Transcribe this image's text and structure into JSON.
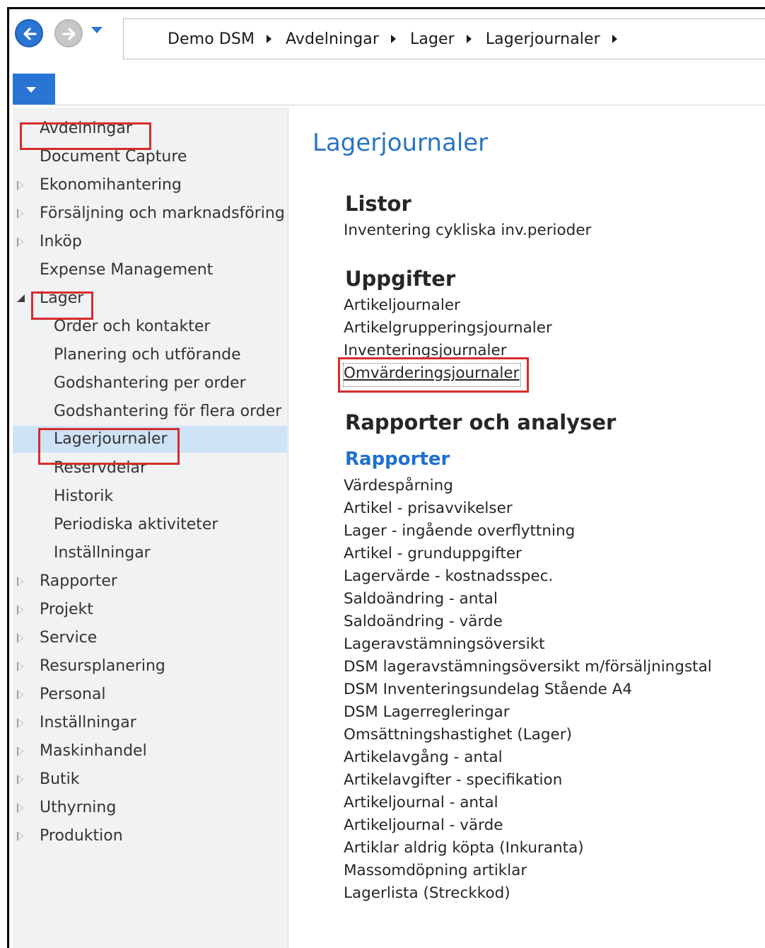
{
  "breadcrumb": [
    "Demo DSM",
    "Avdelningar",
    "Lager",
    "Lagerjournaler"
  ],
  "nav": [
    {
      "label": "Avdelningar",
      "level": 0,
      "expander": "none",
      "highlighted": true
    },
    {
      "label": "Document Capture",
      "level": 0,
      "expander": "none"
    },
    {
      "label": "Ekonomihantering",
      "level": 0,
      "expander": "collapsed"
    },
    {
      "label": "Försäljning och marknadsföring",
      "level": 0,
      "expander": "collapsed"
    },
    {
      "label": "Inköp",
      "level": 0,
      "expander": "collapsed"
    },
    {
      "label": "Expense Management",
      "level": 0,
      "expander": "none"
    },
    {
      "label": "Lager",
      "level": 0,
      "expander": "expanded",
      "highlighted": true
    },
    {
      "label": "Order och kontakter",
      "level": 1
    },
    {
      "label": "Planering och utförande",
      "level": 1
    },
    {
      "label": "Godshantering per order",
      "level": 1
    },
    {
      "label": "Godshantering för flera order",
      "level": 1
    },
    {
      "label": "Lagerjournaler",
      "level": 1,
      "selected": true,
      "highlighted": true
    },
    {
      "label": "Reservdelar",
      "level": 1
    },
    {
      "label": "Historik",
      "level": 1
    },
    {
      "label": "Periodiska aktiviteter",
      "level": 1
    },
    {
      "label": "Inställningar",
      "level": 1
    },
    {
      "label": "Rapporter",
      "level": 0,
      "expander": "collapsed"
    },
    {
      "label": "Projekt",
      "level": 0,
      "expander": "collapsed"
    },
    {
      "label": "Service",
      "level": 0,
      "expander": "collapsed"
    },
    {
      "label": "Resursplanering",
      "level": 0,
      "expander": "collapsed"
    },
    {
      "label": "Personal",
      "level": 0,
      "expander": "collapsed"
    },
    {
      "label": "Inställningar",
      "level": 0,
      "expander": "collapsed"
    },
    {
      "label": "Maskinhandel",
      "level": 0,
      "expander": "collapsed"
    },
    {
      "label": "Butik",
      "level": 0,
      "expander": "collapsed"
    },
    {
      "label": "Uthyrning",
      "level": 0,
      "expander": "collapsed"
    },
    {
      "label": "Produktion",
      "level": 0,
      "expander": "collapsed"
    }
  ],
  "content": {
    "title": "Lagerjournaler",
    "listor": {
      "heading": "Listor",
      "items": [
        "Inventering cykliska inv.perioder"
      ]
    },
    "uppgifter": {
      "heading": "Uppgifter",
      "items": [
        "Artikeljournaler",
        "Artikelgrupperingsjournaler",
        "Inventeringsjournaler",
        "Omvärderingsjournaler"
      ]
    },
    "rapporter": {
      "heading": "Rapporter och analyser",
      "subheading": "Rapporter",
      "items": [
        "Värdespårning",
        "Artikel - prisavvikelser",
        "Lager - ingående overflyttning",
        "Artikel - grunduppgifter",
        "Lagervärde - kostnadsspec.",
        "Saldoändring - antal",
        "Saldoändring - värde",
        "Lageravstämningsöversikt",
        "DSM lageravstämningsöversikt m/försäljningstal",
        "DSM Inventeringsundelag Stående A4",
        "DSM Lagerregleringar",
        "Omsättningshastighet (Lager)",
        "Artikelavgång - antal",
        "Artikelavgifter - specifikation",
        "Artikeljournal - antal",
        "Artikeljournal - värde",
        "Artiklar aldrig köpta (Inkuranta)",
        "Massomdöpning artiklar",
        "Lagerlista (Streckkod)"
      ]
    }
  },
  "colors": {
    "accent": "#2a74d4",
    "highlight_box": "#d62c2c",
    "selected_bg": "#cfe3f7",
    "title": "#2a74c4"
  }
}
